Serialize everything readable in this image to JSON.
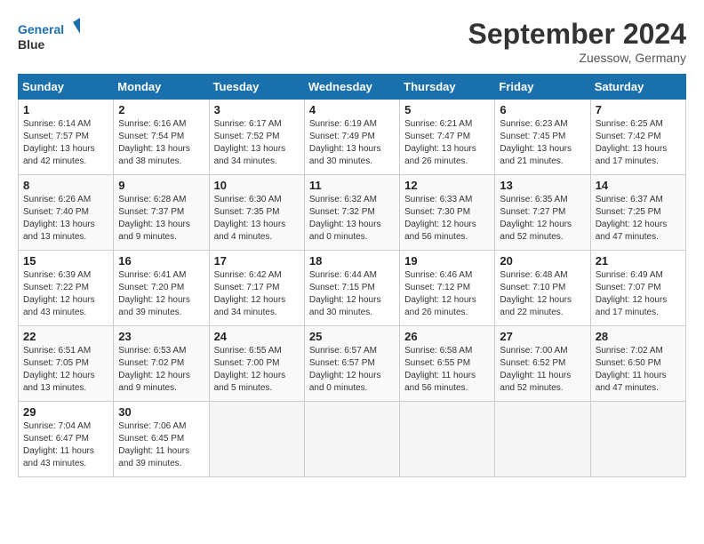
{
  "header": {
    "logo_line1": "General",
    "logo_line2": "Blue",
    "month": "September 2024",
    "location": "Zuessow, Germany"
  },
  "weekdays": [
    "Sunday",
    "Monday",
    "Tuesday",
    "Wednesday",
    "Thursday",
    "Friday",
    "Saturday"
  ],
  "weeks": [
    [
      {
        "day": "1",
        "info": "Sunrise: 6:14 AM\nSunset: 7:57 PM\nDaylight: 13 hours\nand 42 minutes."
      },
      {
        "day": "2",
        "info": "Sunrise: 6:16 AM\nSunset: 7:54 PM\nDaylight: 13 hours\nand 38 minutes."
      },
      {
        "day": "3",
        "info": "Sunrise: 6:17 AM\nSunset: 7:52 PM\nDaylight: 13 hours\nand 34 minutes."
      },
      {
        "day": "4",
        "info": "Sunrise: 6:19 AM\nSunset: 7:49 PM\nDaylight: 13 hours\nand 30 minutes."
      },
      {
        "day": "5",
        "info": "Sunrise: 6:21 AM\nSunset: 7:47 PM\nDaylight: 13 hours\nand 26 minutes."
      },
      {
        "day": "6",
        "info": "Sunrise: 6:23 AM\nSunset: 7:45 PM\nDaylight: 13 hours\nand 21 minutes."
      },
      {
        "day": "7",
        "info": "Sunrise: 6:25 AM\nSunset: 7:42 PM\nDaylight: 13 hours\nand 17 minutes."
      }
    ],
    [
      {
        "day": "8",
        "info": "Sunrise: 6:26 AM\nSunset: 7:40 PM\nDaylight: 13 hours\nand 13 minutes."
      },
      {
        "day": "9",
        "info": "Sunrise: 6:28 AM\nSunset: 7:37 PM\nDaylight: 13 hours\nand 9 minutes."
      },
      {
        "day": "10",
        "info": "Sunrise: 6:30 AM\nSunset: 7:35 PM\nDaylight: 13 hours\nand 4 minutes."
      },
      {
        "day": "11",
        "info": "Sunrise: 6:32 AM\nSunset: 7:32 PM\nDaylight: 13 hours\nand 0 minutes."
      },
      {
        "day": "12",
        "info": "Sunrise: 6:33 AM\nSunset: 7:30 PM\nDaylight: 12 hours\nand 56 minutes."
      },
      {
        "day": "13",
        "info": "Sunrise: 6:35 AM\nSunset: 7:27 PM\nDaylight: 12 hours\nand 52 minutes."
      },
      {
        "day": "14",
        "info": "Sunrise: 6:37 AM\nSunset: 7:25 PM\nDaylight: 12 hours\nand 47 minutes."
      }
    ],
    [
      {
        "day": "15",
        "info": "Sunrise: 6:39 AM\nSunset: 7:22 PM\nDaylight: 12 hours\nand 43 minutes."
      },
      {
        "day": "16",
        "info": "Sunrise: 6:41 AM\nSunset: 7:20 PM\nDaylight: 12 hours\nand 39 minutes."
      },
      {
        "day": "17",
        "info": "Sunrise: 6:42 AM\nSunset: 7:17 PM\nDaylight: 12 hours\nand 34 minutes."
      },
      {
        "day": "18",
        "info": "Sunrise: 6:44 AM\nSunset: 7:15 PM\nDaylight: 12 hours\nand 30 minutes."
      },
      {
        "day": "19",
        "info": "Sunrise: 6:46 AM\nSunset: 7:12 PM\nDaylight: 12 hours\nand 26 minutes."
      },
      {
        "day": "20",
        "info": "Sunrise: 6:48 AM\nSunset: 7:10 PM\nDaylight: 12 hours\nand 22 minutes."
      },
      {
        "day": "21",
        "info": "Sunrise: 6:49 AM\nSunset: 7:07 PM\nDaylight: 12 hours\nand 17 minutes."
      }
    ],
    [
      {
        "day": "22",
        "info": "Sunrise: 6:51 AM\nSunset: 7:05 PM\nDaylight: 12 hours\nand 13 minutes."
      },
      {
        "day": "23",
        "info": "Sunrise: 6:53 AM\nSunset: 7:02 PM\nDaylight: 12 hours\nand 9 minutes."
      },
      {
        "day": "24",
        "info": "Sunrise: 6:55 AM\nSunset: 7:00 PM\nDaylight: 12 hours\nand 5 minutes."
      },
      {
        "day": "25",
        "info": "Sunrise: 6:57 AM\nSunset: 6:57 PM\nDaylight: 12 hours\nand 0 minutes."
      },
      {
        "day": "26",
        "info": "Sunrise: 6:58 AM\nSunset: 6:55 PM\nDaylight: 11 hours\nand 56 minutes."
      },
      {
        "day": "27",
        "info": "Sunrise: 7:00 AM\nSunset: 6:52 PM\nDaylight: 11 hours\nand 52 minutes."
      },
      {
        "day": "28",
        "info": "Sunrise: 7:02 AM\nSunset: 6:50 PM\nDaylight: 11 hours\nand 47 minutes."
      }
    ],
    [
      {
        "day": "29",
        "info": "Sunrise: 7:04 AM\nSunset: 6:47 PM\nDaylight: 11 hours\nand 43 minutes."
      },
      {
        "day": "30",
        "info": "Sunrise: 7:06 AM\nSunset: 6:45 PM\nDaylight: 11 hours\nand 39 minutes."
      },
      {
        "day": "",
        "info": ""
      },
      {
        "day": "",
        "info": ""
      },
      {
        "day": "",
        "info": ""
      },
      {
        "day": "",
        "info": ""
      },
      {
        "day": "",
        "info": ""
      }
    ]
  ]
}
